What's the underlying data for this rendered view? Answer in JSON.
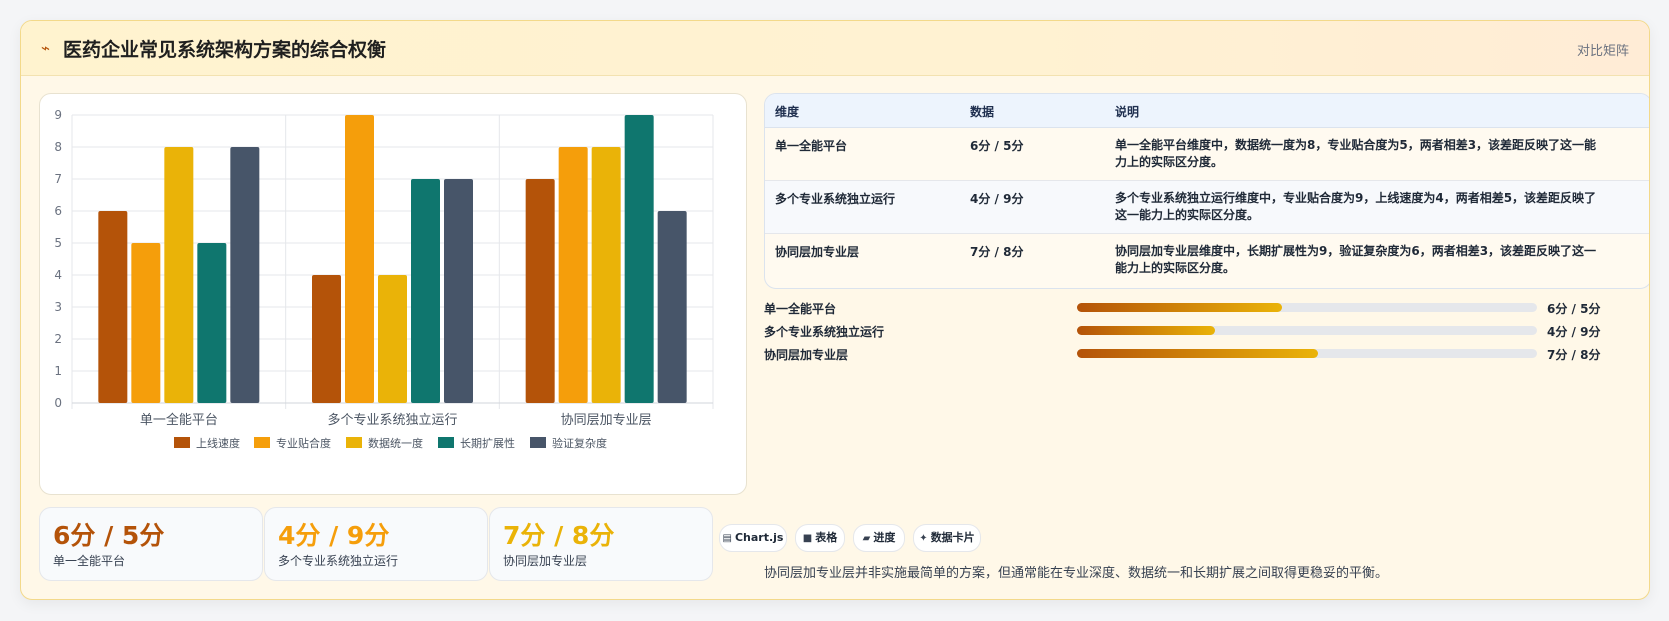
{
  "header": {
    "icon": "lightning-icon",
    "icon_glyph": "⌁",
    "title": "医药企业常见系统架构方案的综合权衡",
    "link": "对比矩阵"
  },
  "colors": {
    "accent_dark": "#b45309",
    "accent": "#f59e0b",
    "gold": "#eab308",
    "teal": "#0f766e",
    "slate": "#475569"
  },
  "chart_data": {
    "type": "bar",
    "categories": [
      "单一全能平台",
      "多个专业系统独立运行",
      "协同层加专业层"
    ],
    "series": [
      {
        "name": "上线速度",
        "color": "#b45309",
        "values": [
          6,
          4,
          7
        ]
      },
      {
        "name": "专业贴合度",
        "color": "#f59e0b",
        "values": [
          5,
          9,
          8
        ]
      },
      {
        "name": "数据统一度",
        "color": "#eab308",
        "values": [
          8,
          4,
          8
        ]
      },
      {
        "name": "长期扩展性",
        "color": "#0f766e",
        "values": [
          5,
          7,
          9
        ]
      },
      {
        "name": "验证复杂度",
        "color": "#475569",
        "values": [
          8,
          7,
          6
        ]
      }
    ],
    "ylim": [
      0,
      9
    ],
    "yticks": [
      0,
      1,
      2,
      3,
      4,
      5,
      6,
      7,
      8,
      9
    ],
    "grid": true,
    "legend": "bottom"
  },
  "stats": [
    {
      "value": "6分 / 5分",
      "label": "单一全能平台",
      "color": "#b45309"
    },
    {
      "value": "4分 / 9分",
      "label": "多个专业系统独立运行",
      "color": "#f59e0b"
    },
    {
      "value": "7分 / 8分",
      "label": "协同层加专业层",
      "color": "#eab308"
    }
  ],
  "table": {
    "headers": [
      "维度",
      "数据",
      "说明"
    ],
    "rows": [
      {
        "dim": "单一全能平台",
        "data": "6分 / 5分",
        "desc": "单一全能平台维度中，数据统一度为8，专业贴合度为5，两者相差3，该差距反映了这一能力上的实际区分度。"
      },
      {
        "dim": "多个专业系统独立运行",
        "data": "4分 / 9分",
        "desc": "多个专业系统独立运行维度中，专业贴合度为9，上线速度为4，两者相差5，该差距反映了这一能力上的实际区分度。"
      },
      {
        "dim": "协同层加专业层",
        "data": "7分 / 8分",
        "desc": "协同层加专业层维度中，长期扩展性为9，验证复杂度为6，两者相差3，该差距反映了这一能力上的实际区分度。"
      }
    ]
  },
  "progress": [
    {
      "label": "单一全能平台",
      "value": "6分 / 5分",
      "fraction": 0.445
    },
    {
      "label": "多个专业系统独立运行",
      "value": "4分 / 9分",
      "fraction": 0.3
    },
    {
      "label": "协同层加专业层",
      "value": "7分 / 8分",
      "fraction": 0.523
    }
  ],
  "chips": [
    {
      "icon": "chart-icon",
      "glyph": "▤",
      "label": "Chart.js"
    },
    {
      "icon": "table-icon",
      "glyph": "■",
      "label": "表格"
    },
    {
      "icon": "progress-icon",
      "glyph": "▰",
      "label": "进度"
    },
    {
      "icon": "sparkle-icon",
      "glyph": "✦",
      "label": "数据卡片"
    }
  ],
  "footer": "协同层加专业层并非实施最简单的方案，但通常能在专业深度、数据统一和长期扩展之间取得更稳妥的平衡。"
}
